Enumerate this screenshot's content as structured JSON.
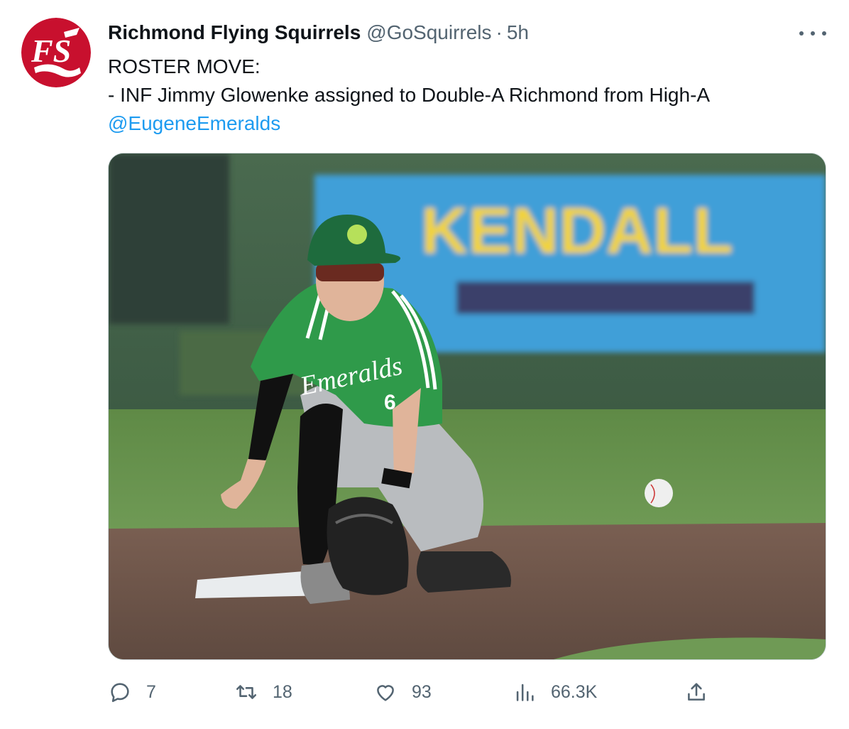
{
  "tweet": {
    "display_name": "Richmond Flying Squirrels",
    "handle": "@GoSquirrels",
    "separator": "·",
    "time": "5h",
    "text_line1": "ROSTER MOVE:",
    "text_line2": "- INF Jimmy Glowenke assigned to Double-A Richmond from High-A",
    "mention": "@EugeneEmeralds",
    "media": {
      "billboard_text": "KENDALL",
      "jersey_text": "Emeralds",
      "jersey_number": "6"
    },
    "avatar_logo": "FS",
    "actions": {
      "reply_count": "7",
      "retweet_count": "18",
      "like_count": "93",
      "view_count": "66.3K"
    }
  },
  "icons": {
    "more": "more-horizontal-icon",
    "reply": "reply-icon",
    "retweet": "retweet-icon",
    "like": "heart-icon",
    "views": "views-icon",
    "share": "share-icon"
  },
  "colors": {
    "brand_red": "#c8102e",
    "link_blue": "#1d9bf0",
    "muted_gray": "#536471",
    "text": "#0f1419"
  }
}
